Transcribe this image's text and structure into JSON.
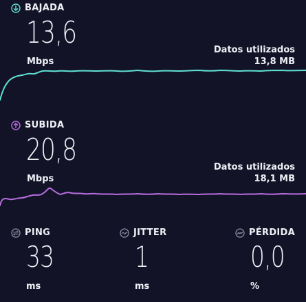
{
  "download": {
    "label": "BAJADA",
    "value": "13,6",
    "unit": "Mbps",
    "data_used_label": "Datos utilizados",
    "data_used_value": "13,8 MB",
    "icon": "download-arrow-icon",
    "color": "#5fe0d3"
  },
  "upload": {
    "label": "SUBIDA",
    "value": "20,8",
    "unit": "Mbps",
    "data_used_label": "Datos utilizados",
    "data_used_value": "18,1 MB",
    "icon": "upload-arrow-icon",
    "color": "#b86ee0"
  },
  "stats": {
    "ping": {
      "label": "PING",
      "value": "33",
      "unit": "ms",
      "icon": "ping-icon"
    },
    "jitter": {
      "label": "JITTER",
      "value": "1",
      "unit": "ms",
      "icon": "jitter-icon"
    },
    "loss": {
      "label": "PÉRDIDA",
      "value": "0,0",
      "unit": "%",
      "icon": "packet-loss-icon"
    }
  }
}
